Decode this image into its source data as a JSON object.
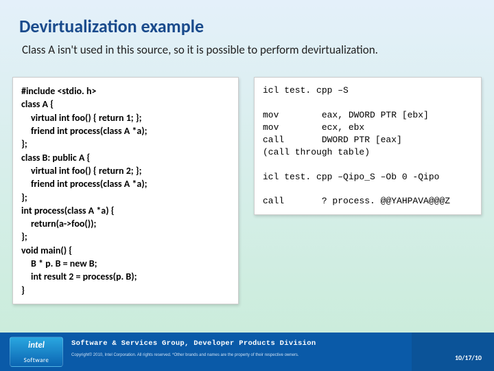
{
  "title": "Devirtualization example",
  "subtitle": "Class A isn't used in this source, so it is possible to perform devirtualization.",
  "code_left": {
    "l1": "#include <stdio. h>",
    "l2": "class A {",
    "l3": "virtual int foo() { return 1; };",
    "l4": "friend int process(class A *a);",
    "l5": "};",
    "l6": "class B: public A {",
    "l7": "virtual int foo() { return 2; };",
    "l8": "friend int process(class A *a);",
    "l9": "};",
    "l10": "int process(class A *a) {",
    "l11": "return(a->foo());",
    "l12": "};",
    "l13": "void main() {",
    "l14": "B * p. B = new B;",
    "l15": "int result 2 = process(p. B);",
    "l16": "}"
  },
  "code_right": "icl test. cpp –S\n\nmov        eax, DWORD PTR [ebx]\nmov        ecx, ebx\ncall       DWORD PTR [eax]\n(call through table)\n\nicl test. cpp –Qipo_S –Ob 0 -Qipo\n\ncall       ? process. @@YAHPAVA@@@Z",
  "footer": {
    "division": "Software & Services Group, Developer Products Division",
    "copyright": "Copyright© 2010, Intel Corporation. All rights reserved. *Other brands and names are the property of their respective owners.",
    "date": "10/17/10"
  },
  "logo": {
    "top": "intel",
    "bottom": "Software"
  }
}
